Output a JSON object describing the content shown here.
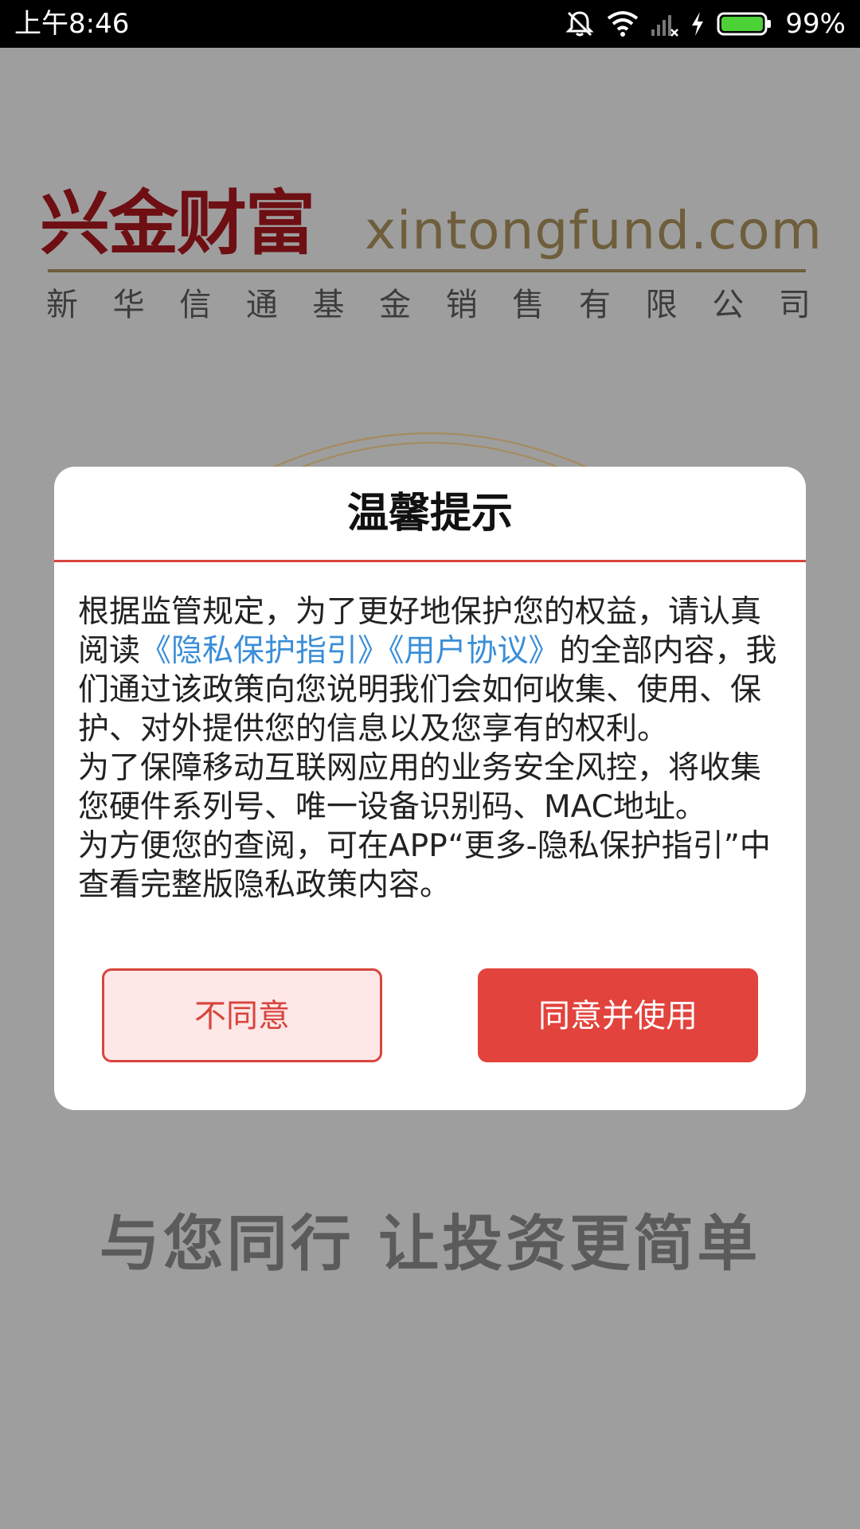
{
  "status_bar": {
    "time": "上午8:46",
    "battery_percent": "99%",
    "icons": [
      "mute-icon",
      "wifi-icon",
      "signal-icon",
      "charging-icon",
      "battery-icon"
    ]
  },
  "splash": {
    "logo_cn": "兴金财富",
    "logo_en": "xintongfund.com",
    "company_chars": [
      "新",
      "华",
      "信",
      "通",
      "基",
      "金",
      "销",
      "售",
      "有",
      "限",
      "公",
      "司"
    ],
    "slogan": "与您同行 让投资更简单"
  },
  "dialog": {
    "title": "温馨提示",
    "body_p1_before": "根据监管规定，为了更好地保护您的权益，请认真阅读",
    "link_privacy": "《隐私保护指引》",
    "link_agreement": "《用户协议》",
    "body_p1_after": "的全部内容，我们通过该政策向您说明我们会如何收集、使用、保护、对外提供您的信息以及您享有的权利。",
    "body_p2": "为了保障移动互联网应用的业务安全风控，将收集您硬件系列号、唯一设备识别码、MAC地址。",
    "body_p3": "为方便您的查阅，可在APP“更多-隐私保护指引”中查看完整版隐私政策内容。",
    "disagree_label": "不同意",
    "agree_label": "同意并使用"
  },
  "colors": {
    "accent": "#e3433d",
    "link": "#3a8ed8",
    "overlay": "#9e9e9e"
  }
}
